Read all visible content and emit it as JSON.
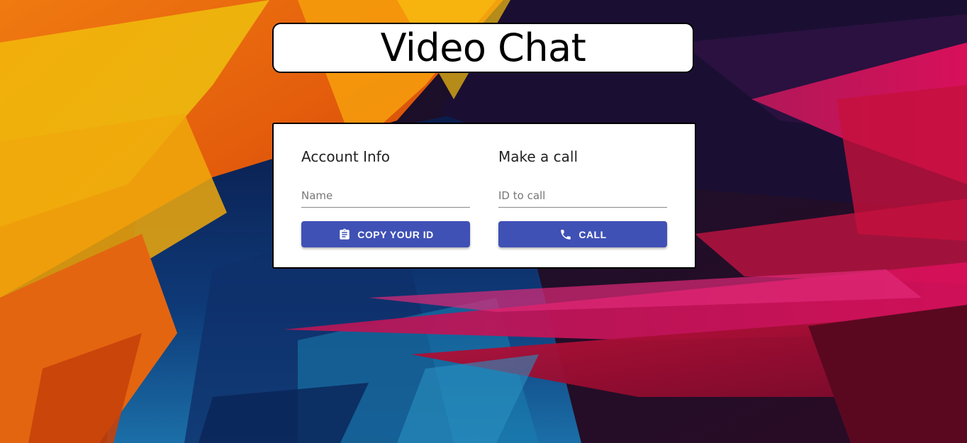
{
  "title": "Video Chat",
  "account": {
    "heading": "Account Info",
    "name_placeholder": "Name",
    "name_value": "",
    "copy_button_label": "COPY YOUR ID",
    "copy_button_icon": "clipboard-icon"
  },
  "call": {
    "heading": "Make a call",
    "id_placeholder": "ID to call",
    "id_value": "",
    "call_button_label": "CALL",
    "call_button_icon": "phone-icon"
  },
  "colors": {
    "button": "#3f51b5",
    "card": "#ffffff",
    "border": "#000000"
  }
}
